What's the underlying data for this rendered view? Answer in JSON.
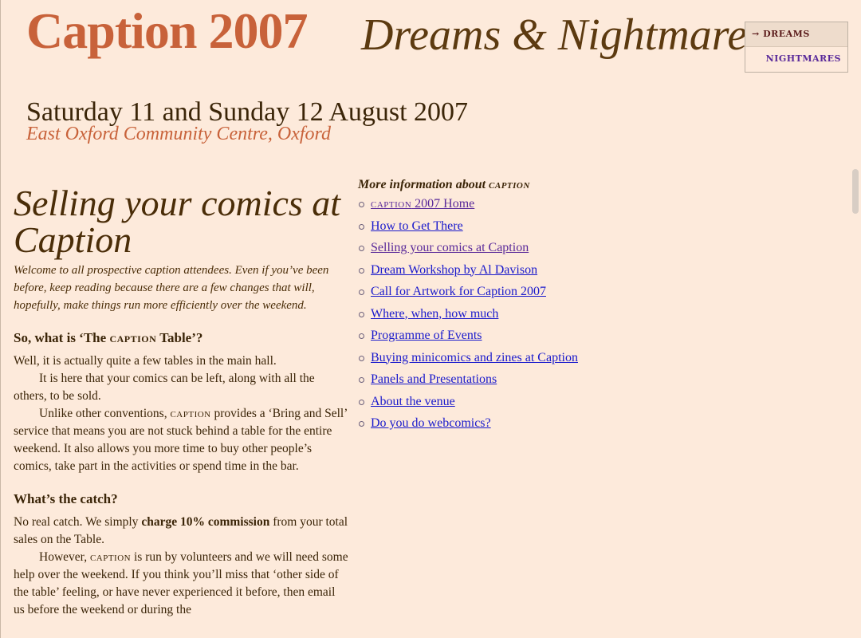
{
  "header": {
    "title": "Caption 2007",
    "subtitle": "Dreams & Nightmares",
    "date": "Saturday 11 and Sunday 12 August 2007",
    "venue": "East Oxford Community Centre, Oxford"
  },
  "theme_switcher": {
    "active_arrow": "→",
    "active_label": "DREAMS",
    "inactive_label": "NIGHTMARES"
  },
  "main": {
    "title": "Selling your comics at Caption",
    "intro": "Welcome to all prospective caption attendees. Even if you’ve been before, keep reading because there are a few changes that will, hopefully, make things run more efficiently over the weekend.",
    "section1": {
      "heading_pre": "So, what is ‘The ",
      "heading_sc": "caption",
      "heading_post": " Table’?",
      "p1": "Well, it is actually quite a few tables in the main hall.",
      "p2": "It is here that your comics can be left, along with all the others, to be sold.",
      "p3_pre": "Unlike other conventions, ",
      "p3_sc": "caption",
      "p3_post": " provides a ‘Bring and Sell’ service that means you are not stuck behind a table for the entire weekend. It also allows you more time to buy other people’s comics, take part in the activities or spend time in the bar."
    },
    "section2": {
      "heading": "What’s the catch?",
      "p1_pre": "No real catch. We simply ",
      "p1_bold": "charge 10% commission",
      "p1_post": " from your total sales on the Table.",
      "p2_pre": "However, ",
      "p2_sc": "caption",
      "p2_post": " is run by volunteers and we will need some help over the weekend. If you think you’ll miss that ‘other side of the table’ feeling, or have never experienced it before, then email us before the weekend or during the"
    }
  },
  "sidebar": {
    "heading_pre": "More information about ",
    "heading_sc": "caption",
    "links": [
      {
        "label_sc": "caption",
        "label": " 2007 Home"
      },
      {
        "label": "How to Get There"
      },
      {
        "label": "Selling your comics at Caption"
      },
      {
        "label": "Dream Workshop by Al Davison"
      },
      {
        "label": "Call for Artwork for Caption 2007"
      },
      {
        "label": "Where, when, how much"
      },
      {
        "label": "Programme of Events"
      },
      {
        "label": "Buying minicomics and zines at Caption"
      },
      {
        "label": "Panels and Presentations"
      },
      {
        "label": "About the venue"
      },
      {
        "label": "Do you do webcomics?"
      }
    ]
  },
  "colors": {
    "background": "#fdeadb",
    "title_accent": "#c8623a",
    "text_brown": "#3b2508",
    "link_blue": "#1a1acc",
    "link_visited": "#5a2a9a"
  }
}
